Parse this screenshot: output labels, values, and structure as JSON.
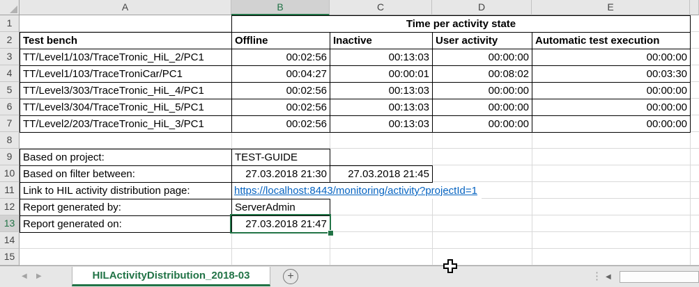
{
  "colors": {
    "excel_green": "#217346",
    "link_blue": "#0563c1",
    "header_bg": "#e7e7e7",
    "selected_header_bg": "#d2d2d2",
    "gridline": "#d9d9d9",
    "table_border": "#000000"
  },
  "grid": {
    "column_headers": [
      "A",
      "B",
      "C",
      "D",
      "E"
    ],
    "row_headers": [
      "1",
      "2",
      "3",
      "4",
      "5",
      "6",
      "7",
      "8",
      "9",
      "10",
      "11",
      "12",
      "13",
      "14",
      "15"
    ],
    "selected_column": "B",
    "selected_row": "13",
    "selected_cell": "B13"
  },
  "sheet": {
    "title_banner": "Time per activity state",
    "table": {
      "columns": [
        "Test bench",
        "Offline",
        "Inactive",
        "User activity",
        "Automatic test execution"
      ],
      "rows": [
        [
          "TT/Level1/103/TraceTronic_HiL_2/PC1",
          "00:02:56",
          "00:13:03",
          "00:00:00",
          "00:00:00"
        ],
        [
          "TT/Level1/103/TraceTroniCar/PC1",
          "00:04:27",
          "00:00:01",
          "00:08:02",
          "00:03:30"
        ],
        [
          "TT/Level3/303/TraceTronic_HiL_4/PC1",
          "00:02:56",
          "00:13:03",
          "00:00:00",
          "00:00:00"
        ],
        [
          "TT/Level3/304/TraceTronic_HiL_5/PC1",
          "00:02:56",
          "00:13:03",
          "00:00:00",
          "00:00:00"
        ],
        [
          "TT/Level2/203/TraceTronic_HiL_3/PC1",
          "00:02:56",
          "00:13:03",
          "00:00:00",
          "00:00:00"
        ]
      ]
    },
    "meta": {
      "project_label": "Based on project:",
      "project_value": "TEST-GUIDE",
      "filter_label": "Based on filter between:",
      "filter_from": "27.03.2018 21:30",
      "filter_to": "27.03.2018 21:45",
      "link_label": "Link to HIL activity distribution page:",
      "link_url": "https://localhost:8443/monitoring/activity?projectId=1",
      "generated_by_label": "Report generated by:",
      "generated_by_value": "ServerAdmin",
      "generated_on_label": "Report generated on:",
      "generated_on_value": "27.03.2018 21:47"
    }
  },
  "tab_bar": {
    "active_tab": "HILActivityDistribution_2018-03"
  },
  "icons": {
    "nav_left": "◀",
    "nav_right": "▶",
    "add_sheet": "+",
    "overflow_dots": "⋮",
    "scroll_left": "◀"
  }
}
